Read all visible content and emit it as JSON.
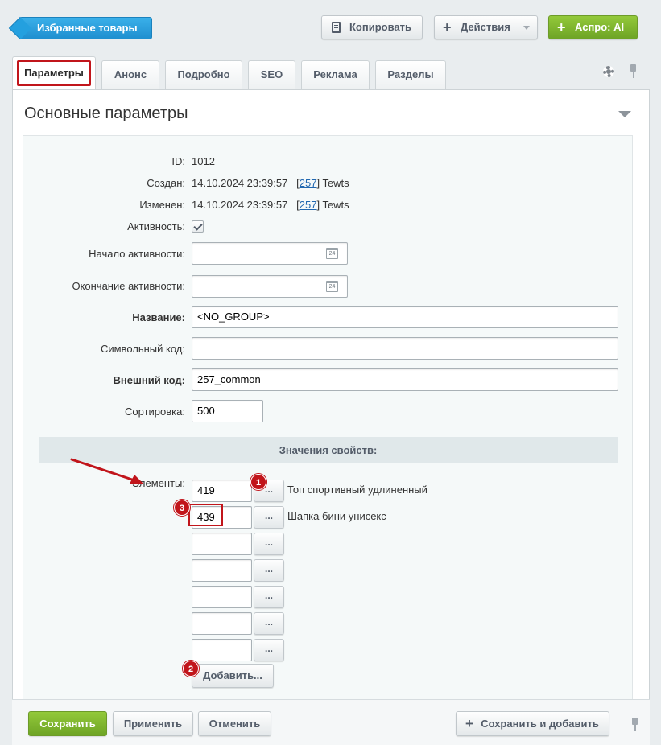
{
  "toolbar": {
    "back_label": "Избранные товары",
    "copy_label": "Копировать",
    "actions_label": "Действия",
    "aspro_label": "Аспро: AI"
  },
  "tabs": [
    {
      "label": "Параметры",
      "active": true
    },
    {
      "label": "Анонс"
    },
    {
      "label": "Подробно"
    },
    {
      "label": "SEO"
    },
    {
      "label": "Реклама"
    },
    {
      "label": "Разделы"
    }
  ],
  "section": {
    "title": "Основные параметры"
  },
  "fields": {
    "id": {
      "label": "ID:",
      "value": "1012"
    },
    "created": {
      "label": "Создан:",
      "date": "14.10.2024 23:39:57",
      "user_id": "257",
      "user_name": "Tewts"
    },
    "modified": {
      "label": "Изменен:",
      "date": "14.10.2024 23:39:57",
      "user_id": "257",
      "user_name": "Tewts"
    },
    "active": {
      "label": "Активность:",
      "checked": true
    },
    "active_from": {
      "label": "Начало активности:",
      "value": ""
    },
    "active_to": {
      "label": "Окончание активности:",
      "value": ""
    },
    "name": {
      "label": "Название:",
      "value": "<NO_GROUP>"
    },
    "code": {
      "label": "Символьный код:",
      "value": ""
    },
    "xml_id": {
      "label": "Внешний код:",
      "value": "257_common"
    },
    "sort": {
      "label": "Сортировка:",
      "value": "500"
    }
  },
  "properties": {
    "header": "Значения свойств:",
    "elements_label": "Элементы:",
    "items": [
      {
        "value": "419",
        "name": "Топ спортивный удлиненный"
      },
      {
        "value": "439",
        "name": "Шапка бини унисекс"
      },
      {
        "value": "",
        "name": ""
      },
      {
        "value": "",
        "name": ""
      },
      {
        "value": "",
        "name": ""
      },
      {
        "value": "",
        "name": ""
      },
      {
        "value": "",
        "name": ""
      }
    ],
    "pick_label": "...",
    "add_label": "Добавить..."
  },
  "annotations": {
    "badge1": "1",
    "badge2": "2",
    "badge3": "3",
    "color": "#c1151b"
  },
  "calendar_icon_text": "24",
  "bottom": {
    "save_label": "Сохранить",
    "apply_label": "Применить",
    "cancel_label": "Отменить",
    "save_add_label": "Сохранить и добавить"
  }
}
